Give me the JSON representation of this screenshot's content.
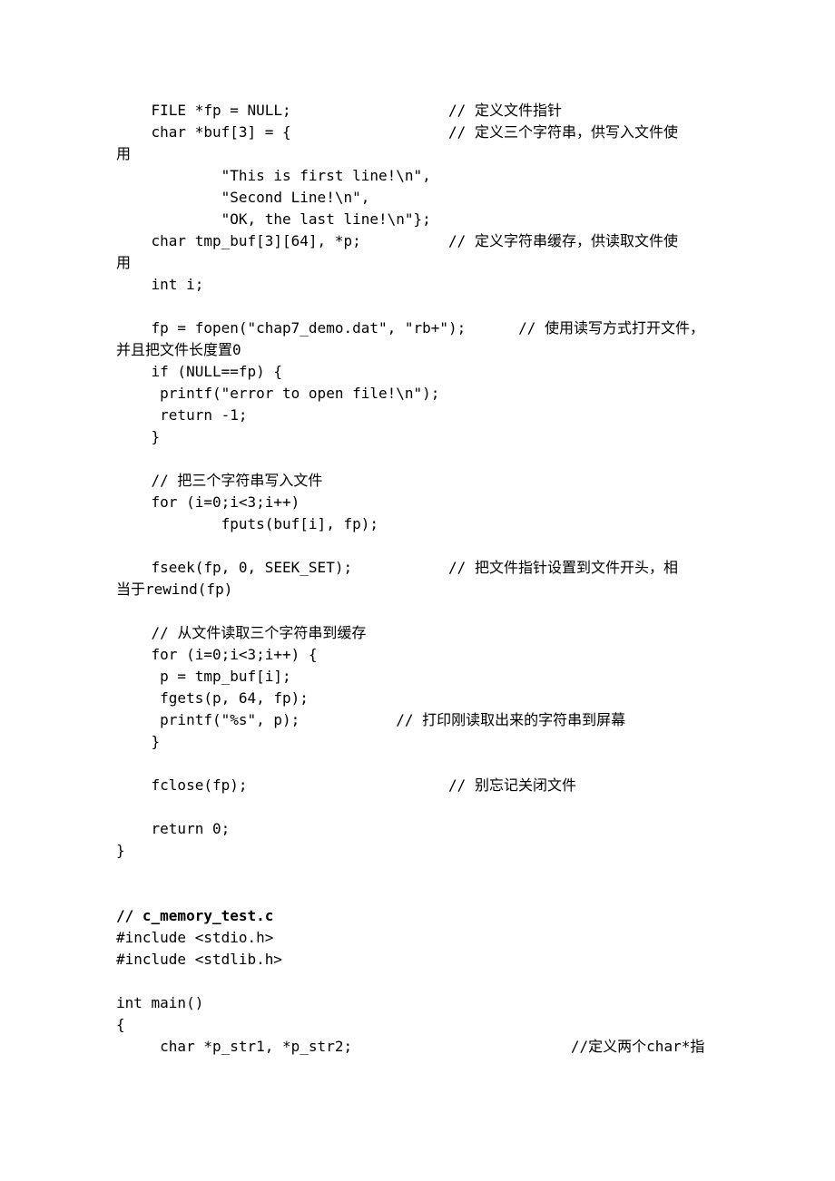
{
  "code": {
    "l01": "    FILE *fp = NULL;                  // 定义文件指针",
    "l02": "    char *buf[3] = {                  // 定义三个字符串，供写入文件使",
    "l03": "用",
    "l04": "            \"This is first line!\\n\",",
    "l05": "            \"Second Line!\\n\",",
    "l06": "            \"OK, the last line!\\n\"};",
    "l07": "    char tmp_buf[3][64], *p;          // 定义字符串缓存，供读取文件使",
    "l08": "用",
    "l09": "    int i;",
    "l10": "",
    "l11": "    fp = fopen(\"chap7_demo.dat\", \"rb+\");      // 使用读写方式打开文件，",
    "l12": "并且把文件长度置0",
    "l13": "    if (NULL==fp) {",
    "l14": "     printf(\"error to open file!\\n\");",
    "l15": "     return -1;",
    "l16": "    }",
    "l17": "",
    "l18": "    // 把三个字符串写入文件",
    "l19": "    for (i=0;i<3;i++)",
    "l20": "            fputs(buf[i], fp);",
    "l21": "",
    "l22": "    fseek(fp, 0, SEEK_SET);           // 把文件指针设置到文件开头，相",
    "l23": "当于rewind(fp)",
    "l24": "",
    "l25": "    // 从文件读取三个字符串到缓存",
    "l26": "    for (i=0;i<3;i++) {",
    "l27": "     p = tmp_buf[i];",
    "l28": "     fgets(p, 64, fp);",
    "l29": "     printf(\"%s\", p);           // 打印刚读取出来的字符串到屏幕",
    "l30": "    }",
    "l31": "",
    "l32": "    fclose(fp);                       // 别忘记关闭文件",
    "l33": "",
    "l34": "    return 0;",
    "l35": "}",
    "l36": "",
    "l37": "",
    "l38": "// c_memory_test.c",
    "l39": "#include <stdio.h>",
    "l40": "#include <stdlib.h>",
    "l41": "",
    "l42": "int main()",
    "l43": "{",
    "l44": "     char *p_str1, *p_str2;                         //定义两个char*指"
  }
}
